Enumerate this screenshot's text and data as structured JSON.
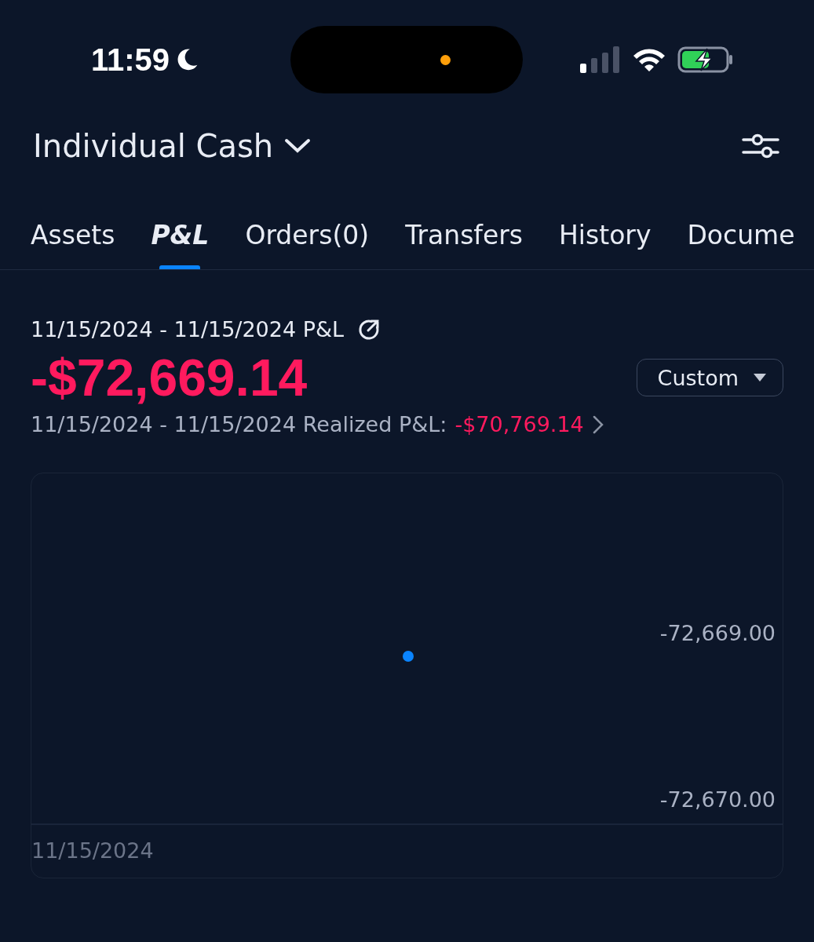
{
  "status_bar": {
    "time": "11:59"
  },
  "header": {
    "account": "Individual Cash"
  },
  "tabs": [
    {
      "label": "Assets",
      "selected": false
    },
    {
      "label": "P&L",
      "selected": true
    },
    {
      "label": "Orders(0)",
      "selected": false
    },
    {
      "label": "Transfers",
      "selected": false
    },
    {
      "label": "History",
      "selected": false
    },
    {
      "label": "Docume",
      "selected": false
    }
  ],
  "pnl": {
    "period_label": "11/15/2024 - 11/15/2024 P&L",
    "amount": "-$72,669.14",
    "range_button": "Custom",
    "realized_label": "11/15/2024 - 11/15/2024 Realized P&L:",
    "realized_amount": "-$70,769.14"
  },
  "chart": {
    "chart_data": {
      "type": "scatter",
      "x": [
        "11/15/2024"
      ],
      "series": [
        {
          "color": "#0a84ff",
          "values": [
            -72669.14
          ]
        }
      ],
      "ylim": [
        -72670.15,
        -72668.04
      ],
      "yticks": [
        {
          "value": -72669,
          "label": "-72,669.00"
        },
        {
          "value": -72670,
          "label": "-72,670.00"
        }
      ]
    }
  }
}
